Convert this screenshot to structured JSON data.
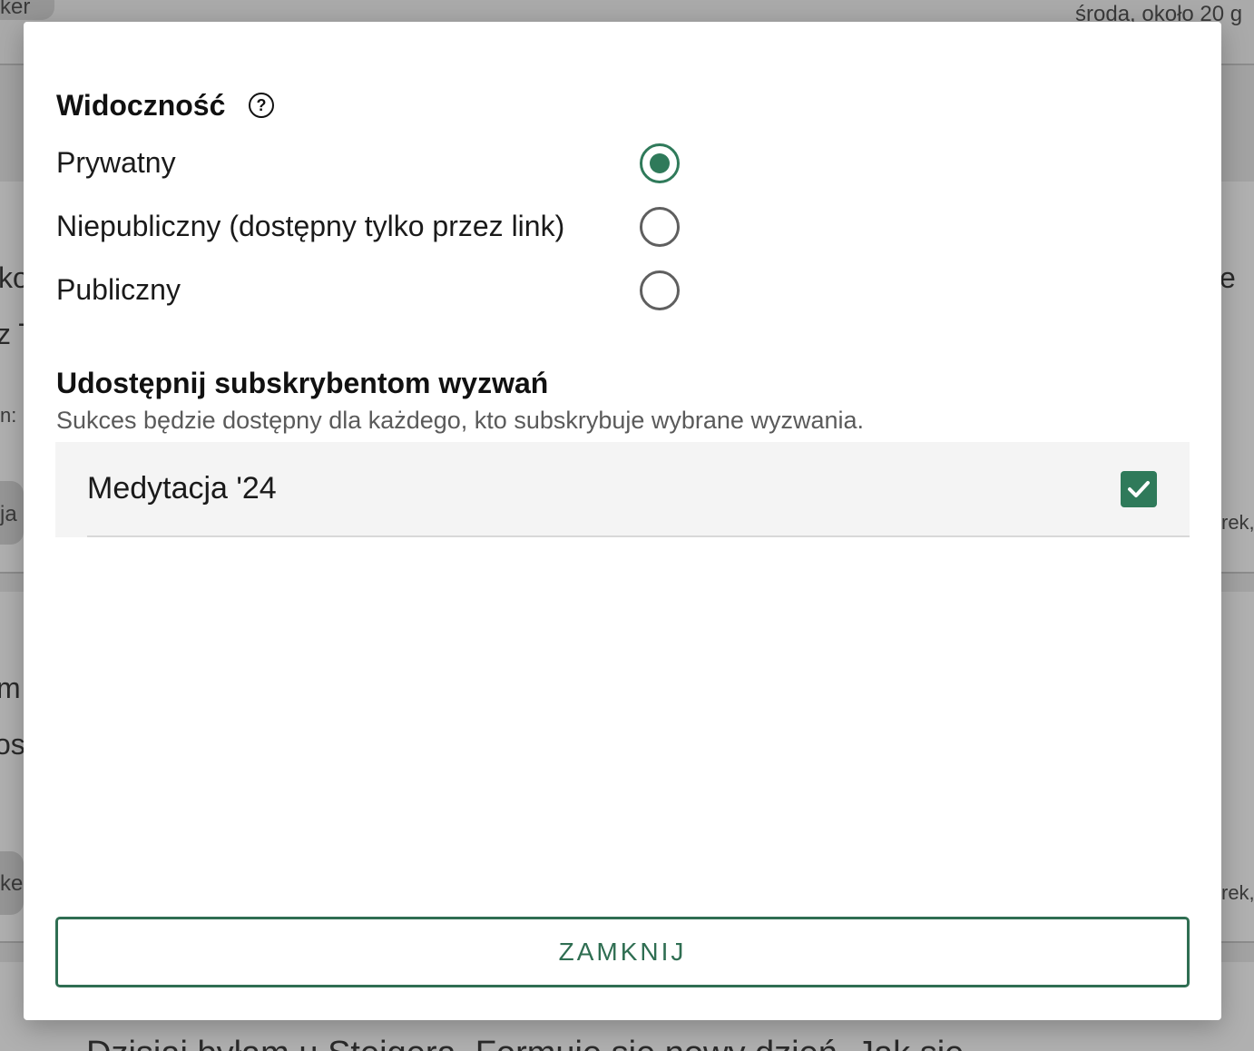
{
  "background": {
    "top_left_chip_text": "ker",
    "top_right_text": "środa, około 20 g",
    "left_fragments": [
      "ko",
      "z T",
      "n:",
      "ja",
      "m",
      "os",
      "ke"
    ],
    "right_fragments": [
      "e",
      "rek,",
      "rek,"
    ],
    "bottom_text": "Dzisiaj byłam u Steigera. Formuje się nowy dzień. Jak się"
  },
  "modal": {
    "visibility": {
      "title": "Widoczność",
      "help_icon_glyph": "?",
      "options": [
        {
          "label": "Prywatny",
          "checked": true
        },
        {
          "label": "Niepubliczny (dostępny tylko przez link)",
          "checked": false
        },
        {
          "label": "Publiczny",
          "checked": false
        }
      ]
    },
    "share": {
      "title": "Udostępnij subskrybentom wyzwań",
      "subtitle": "Sukces będzie dostępny dla każdego, kto subskrybuje wybrane wyzwania.",
      "challenges": [
        {
          "label": "Medytacja '24",
          "checked": true
        }
      ]
    },
    "close_label": "ZAMKNIJ"
  },
  "colors": {
    "accent": "#2f7a5a",
    "button_border": "#2f6e52",
    "overlay": "#a3a3a3"
  }
}
